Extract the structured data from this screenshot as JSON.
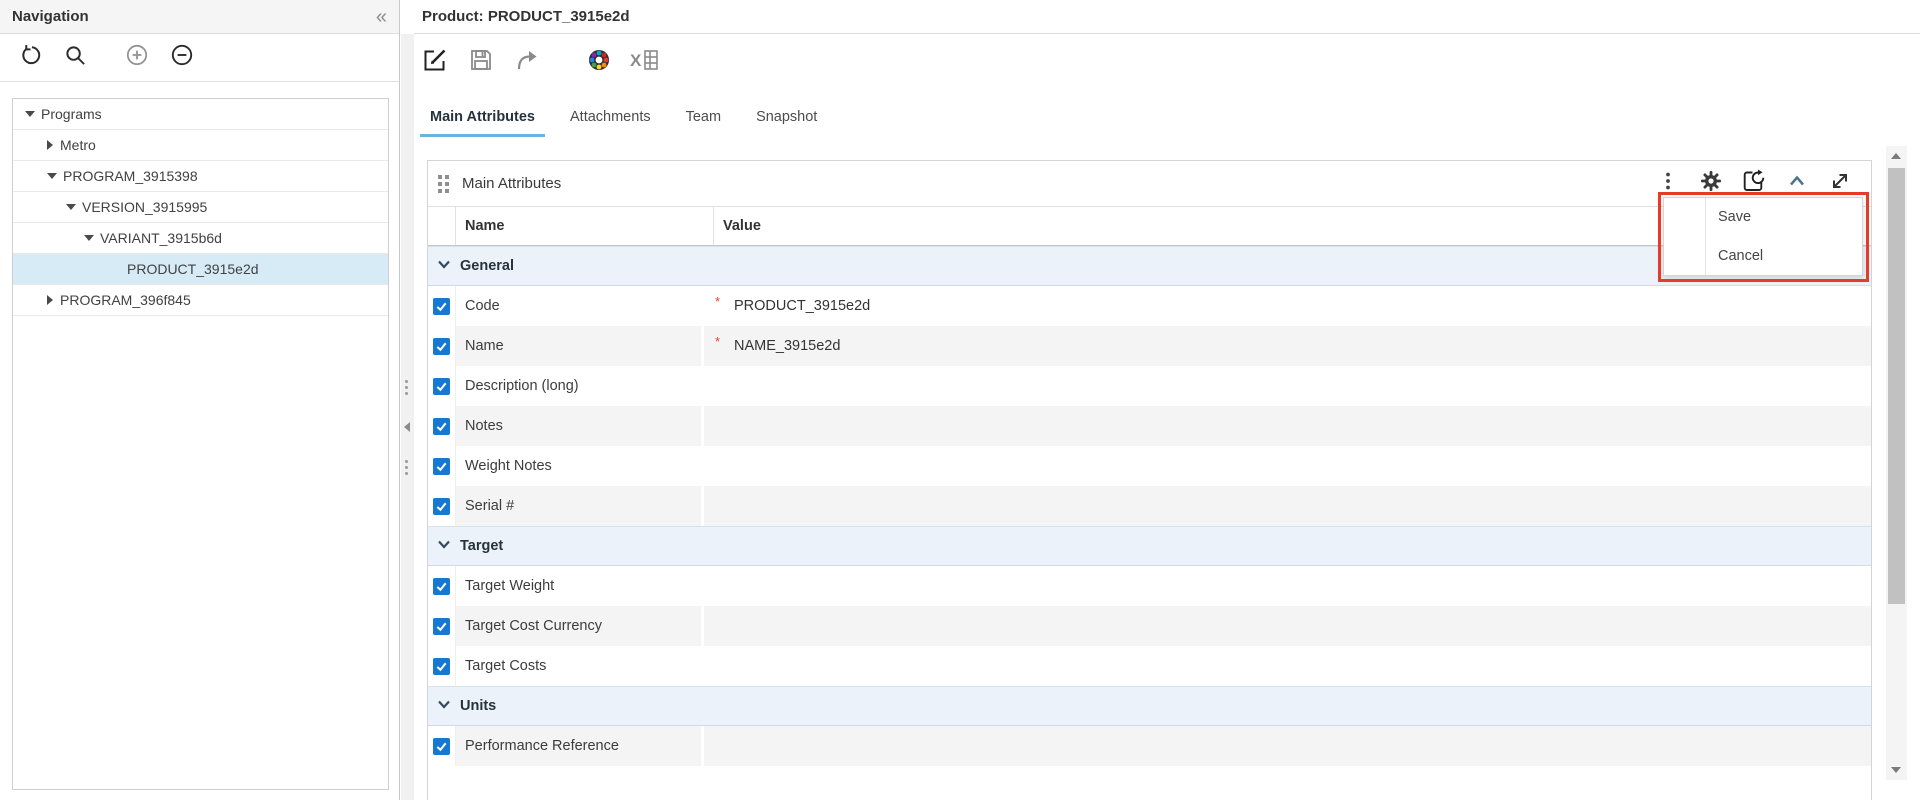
{
  "colors": {
    "tab_accent_blue": "#6ab4dc",
    "checkbox_blue": "#1778d2",
    "tree_selection_blue": "#d7ebf7",
    "section_header_bg": "#ecf2f9",
    "annotation_red": "#e73a28",
    "required_red": "#e0402f"
  },
  "sidebar": {
    "title": "Navigation",
    "collapse_glyph": "«",
    "toolbar_icons": [
      "refresh",
      "search",
      "zoom-in-circle",
      "zoom-out-circle"
    ],
    "tree": [
      {
        "label": "Programs",
        "level": 0,
        "state": "expanded",
        "selected": false
      },
      {
        "label": "Metro",
        "level": 1,
        "state": "collapsed",
        "selected": false
      },
      {
        "label": "PROGRAM_3915398",
        "level": 1,
        "state": "expanded",
        "selected": false
      },
      {
        "label": "VERSION_3915995",
        "level": 2,
        "state": "expanded",
        "selected": false
      },
      {
        "label": "VARIANT_3915b6d",
        "level": 3,
        "state": "expanded",
        "selected": false
      },
      {
        "label": "PRODUCT_3915e2d",
        "level": 4,
        "state": "leaf",
        "selected": true
      },
      {
        "label": "PROGRAM_396f845",
        "level": 1,
        "state": "collapsed",
        "selected": false
      }
    ]
  },
  "main": {
    "title": "Product: PRODUCT_3915e2d",
    "toolbar_icons": [
      "edit",
      "save",
      "share-forward",
      "color-wheel",
      "excel-export"
    ],
    "tabs": [
      {
        "label": "Main Attributes",
        "active": true
      },
      {
        "label": "Attachments",
        "active": false
      },
      {
        "label": "Team",
        "active": false
      },
      {
        "label": "Snapshot",
        "active": false
      }
    ],
    "panel": {
      "title": "Main Attributes",
      "header_icons": [
        "kebab-menu",
        "gear",
        "history-restore",
        "collapse-up",
        "expand-fullscreen"
      ],
      "columns": {
        "name": "Name",
        "value": "Value"
      },
      "required_marker": "*",
      "sections": [
        {
          "title": "General",
          "rows": [
            {
              "name": "Code",
              "value": "PRODUCT_3915e2d",
              "required": true,
              "checked": true
            },
            {
              "name": "Name",
              "value": "NAME_3915e2d",
              "required": true,
              "checked": true
            },
            {
              "name": "Description (long)",
              "value": "",
              "required": false,
              "checked": true
            },
            {
              "name": "Notes",
              "value": "",
              "required": false,
              "checked": true
            },
            {
              "name": "Weight Notes",
              "value": "",
              "required": false,
              "checked": true
            },
            {
              "name": "Serial #",
              "value": "",
              "required": false,
              "checked": true
            }
          ]
        },
        {
          "title": "Target",
          "rows": [
            {
              "name": "Target Weight",
              "value": "",
              "required": false,
              "checked": true
            },
            {
              "name": "Target Cost Currency",
              "value": "",
              "required": false,
              "checked": true
            },
            {
              "name": "Target Costs",
              "value": "",
              "required": false,
              "checked": true
            }
          ]
        },
        {
          "title": "Units",
          "rows": [
            {
              "name": "Performance Reference",
              "value": "",
              "required": false,
              "checked": true
            }
          ]
        }
      ],
      "menu": {
        "items": [
          {
            "label": "Save"
          },
          {
            "label": "Cancel"
          }
        ]
      }
    }
  }
}
